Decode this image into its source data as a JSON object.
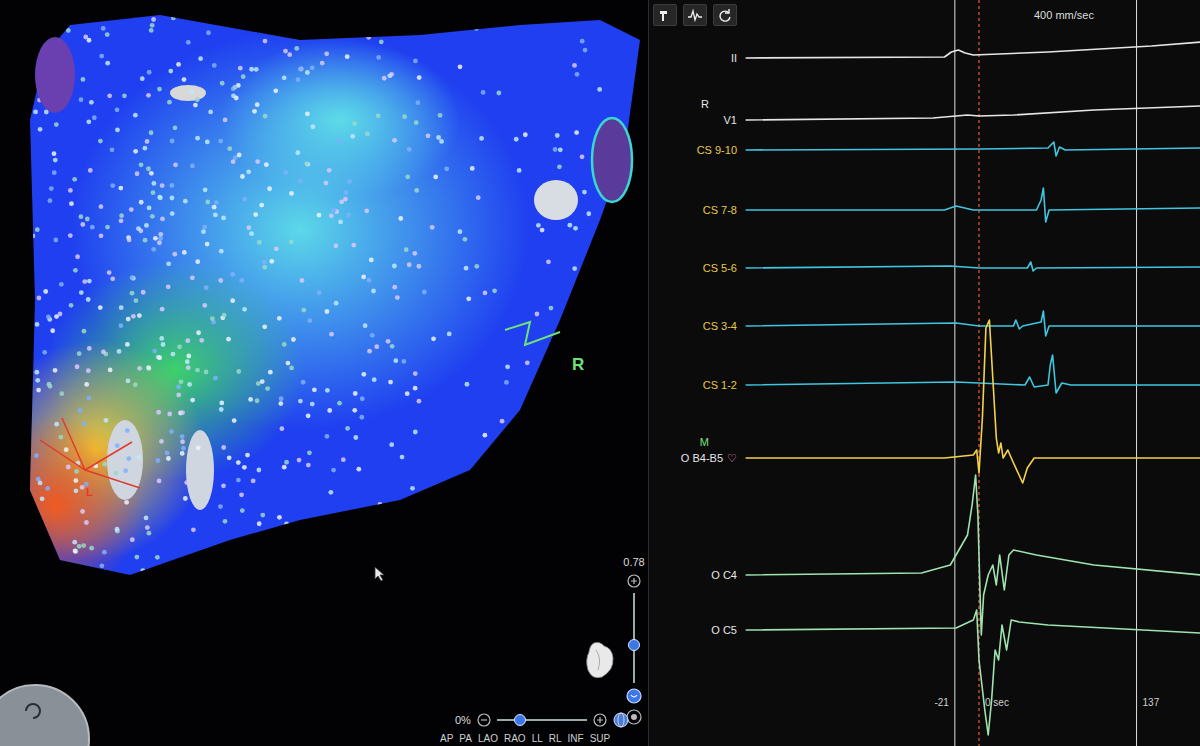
{
  "map": {
    "labels": [
      {
        "text": "R",
        "color": "#6fe07a"
      },
      {
        "text": "L",
        "color": "#e23a2a"
      }
    ],
    "opacity": {
      "reading": "0.78",
      "level": 0.45
    },
    "zoom": {
      "reading": "0%",
      "level": 0.2
    },
    "views": [
      "AP",
      "PA",
      "LAO",
      "RAO",
      "LL",
      "RL",
      "INF",
      "SUP"
    ]
  },
  "signals": {
    "speed": "400 mm/sec",
    "channels": [
      {
        "name": "II",
        "color": "#e6e6e6",
        "label_color": "#e6e6e6",
        "points": [
          [
            -203,
            0
          ],
          [
            -30,
            1
          ],
          [
            -24,
            6
          ],
          [
            -18,
            8
          ],
          [
            -12,
            5
          ],
          [
            -5,
            3
          ],
          [
            60,
            6
          ],
          [
            150,
            12
          ],
          [
            193,
            16
          ]
        ]
      },
      {
        "name": "V1",
        "tag": {
          "text": "R",
          "color": "#e6e6e6"
        },
        "color": "#e6e6e6",
        "label_color": "#e6e6e6",
        "points": [
          [
            -203,
            0
          ],
          [
            -40,
            2
          ],
          [
            -10,
            5
          ],
          [
            0,
            4
          ],
          [
            30,
            5
          ],
          [
            100,
            10
          ],
          [
            193,
            14
          ]
        ]
      },
      {
        "name": "CS 9-10",
        "color": "#3fc6e0",
        "label_color": "#e8c84a",
        "points": [
          [
            -203,
            0
          ],
          [
            0,
            1
          ],
          [
            60,
            2
          ],
          [
            65,
            8
          ],
          [
            67,
            -6
          ],
          [
            70,
            3
          ],
          [
            75,
            0
          ],
          [
            193,
            2
          ]
        ]
      },
      {
        "name": "CS 7-8",
        "color": "#3fc6e0",
        "label_color": "#e8c84a",
        "points": [
          [
            -203,
            0
          ],
          [
            -30,
            0
          ],
          [
            -20,
            4
          ],
          [
            -5,
            0
          ],
          [
            50,
            0
          ],
          [
            54,
            10
          ],
          [
            56,
            22
          ],
          [
            58,
            -12
          ],
          [
            61,
            0
          ],
          [
            193,
            2
          ]
        ]
      },
      {
        "name": "CS 5-6",
        "color": "#3fc6e0",
        "label_color": "#e8c84a",
        "points": [
          [
            -203,
            0
          ],
          [
            -25,
            2
          ],
          [
            0,
            0
          ],
          [
            42,
            0
          ],
          [
            45,
            6
          ],
          [
            47,
            -3
          ],
          [
            50,
            0
          ],
          [
            193,
            1
          ]
        ]
      },
      {
        "name": "CS 3-4",
        "color": "#3fc6e0",
        "label_color": "#e8c84a",
        "points": [
          [
            -203,
            0
          ],
          [
            -20,
            3
          ],
          [
            0,
            0
          ],
          [
            30,
            0
          ],
          [
            32,
            6
          ],
          [
            35,
            -3
          ],
          [
            38,
            0
          ],
          [
            54,
            4
          ],
          [
            56,
            15
          ],
          [
            58,
            -10
          ],
          [
            61,
            0
          ],
          [
            193,
            0
          ]
        ]
      },
      {
        "name": "CS 1-2",
        "color": "#3fc6e0",
        "label_color": "#e8c84a",
        "points": [
          [
            -203,
            0
          ],
          [
            -20,
            3
          ],
          [
            40,
            0
          ],
          [
            44,
            8
          ],
          [
            48,
            -2
          ],
          [
            60,
            0
          ],
          [
            62,
            20
          ],
          [
            64,
            30
          ],
          [
            67,
            -8
          ],
          [
            72,
            2
          ],
          [
            80,
            0
          ],
          [
            193,
            0
          ]
        ]
      },
      {
        "name": "O B4-B5",
        "tag": {
          "text": "M",
          "color": "#7be07b"
        },
        "mark": "♡",
        "color": "#f3d24a",
        "label_color": "#e6e6e6",
        "points": [
          [
            -203,
            0
          ],
          [
            -30,
            0
          ],
          [
            -5,
            3
          ],
          [
            -2,
            8
          ],
          [
            0,
            -15
          ],
          [
            3,
            40
          ],
          [
            6,
            130
          ],
          [
            9,
            138
          ],
          [
            12,
            80
          ],
          [
            15,
            20
          ],
          [
            17,
            5
          ],
          [
            19,
            15
          ],
          [
            21,
            0
          ],
          [
            25,
            8
          ],
          [
            30,
            -5
          ],
          [
            38,
            -25
          ],
          [
            42,
            -10
          ],
          [
            48,
            0
          ],
          [
            193,
            0
          ]
        ]
      },
      {
        "name": "O C4",
        "color": "#9fe3b0",
        "label_color": "#e6e6e6",
        "points": [
          [
            -203,
            0
          ],
          [
            -50,
            2
          ],
          [
            -25,
            10
          ],
          [
            -10,
            40
          ],
          [
            -6,
            70
          ],
          [
            -3,
            100
          ],
          [
            -1,
            60
          ],
          [
            1,
            -20
          ],
          [
            2,
            -60
          ],
          [
            4,
            -20
          ],
          [
            8,
            0
          ],
          [
            12,
            10
          ],
          [
            15,
            -10
          ],
          [
            18,
            20
          ],
          [
            22,
            -15
          ],
          [
            26,
            20
          ],
          [
            30,
            25
          ],
          [
            50,
            20
          ],
          [
            100,
            10
          ],
          [
            193,
            0
          ]
        ]
      },
      {
        "name": "O C5",
        "color": "#9fe3b0",
        "label_color": "#e6e6e6",
        "points": [
          [
            -203,
            0
          ],
          [
            -20,
            2
          ],
          [
            -5,
            10
          ],
          [
            -2,
            20
          ],
          [
            0,
            -30
          ],
          [
            5,
            -80
          ],
          [
            8,
            -105
          ],
          [
            11,
            -70
          ],
          [
            14,
            -20
          ],
          [
            17,
            -30
          ],
          [
            20,
            5
          ],
          [
            24,
            -20
          ],
          [
            28,
            10
          ],
          [
            35,
            8
          ],
          [
            60,
            5
          ],
          [
            193,
            -3
          ]
        ]
      }
    ],
    "time_marks": [
      {
        "text": "-21",
        "t": -21,
        "kind": "cursor"
      },
      {
        "text": "0 sec",
        "t": 0,
        "kind": "reference"
      },
      {
        "text": "137",
        "t": 137,
        "kind": "cursor"
      }
    ]
  }
}
